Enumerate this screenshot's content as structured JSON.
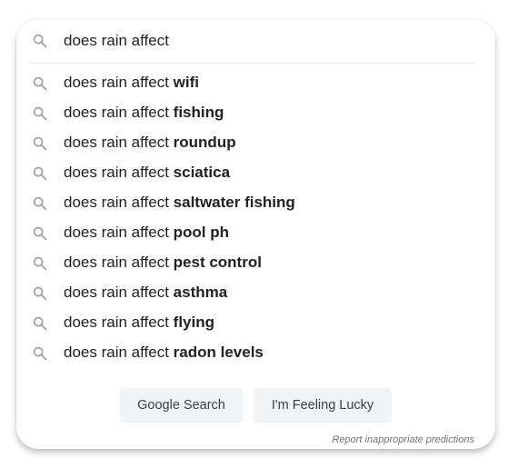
{
  "search": {
    "query": "does rain affect",
    "icon": "search-icon"
  },
  "suggestions": [
    {
      "prefix": "does rain affect ",
      "completion": "wifi"
    },
    {
      "prefix": "does rain affect ",
      "completion": "fishing"
    },
    {
      "prefix": "does rain affect ",
      "completion": "roundup"
    },
    {
      "prefix": "does rain affect ",
      "completion": "sciatica"
    },
    {
      "prefix": "does rain affect ",
      "completion": "saltwater fishing"
    },
    {
      "prefix": "does rain affect ",
      "completion": "pool ph"
    },
    {
      "prefix": "does rain affect ",
      "completion": "pest control"
    },
    {
      "prefix": "does rain affect ",
      "completion": "asthma"
    },
    {
      "prefix": "does rain affect ",
      "completion": "flying"
    },
    {
      "prefix": "does rain affect ",
      "completion": "radon levels"
    }
  ],
  "buttons": {
    "search_label": "Google Search",
    "lucky_label": "I'm Feeling Lucky"
  },
  "footer": {
    "report_label": "Report inappropriate predictions"
  },
  "colors": {
    "text": "#202124",
    "icon": "#9aa0a6",
    "button_bg": "#f1f3f4",
    "button_text": "#3c4043",
    "muted": "#70757a"
  }
}
